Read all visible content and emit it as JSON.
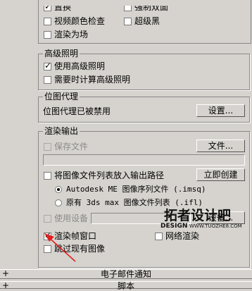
{
  "top": {
    "cut_label_1": "置换",
    "cut_label_2": "强制双面",
    "video_color_check": "视频颜色检查",
    "super_black": "超级黑",
    "render_to_fields": "渲染为场"
  },
  "advanced_lighting": {
    "title": "高级照明",
    "use": "使用高级照明",
    "compute_when_required": "需要时计算高级照明"
  },
  "bitmap_proxies": {
    "title": "位图代理",
    "status": "位图代理已被禁用",
    "settings_button": "设置..."
  },
  "render_output": {
    "title": "渲染输出",
    "save_file": "保存文件",
    "files_button": "文件...",
    "put_image_list": "将图像文件列表放入输出路径",
    "create_now_button": "立即创建",
    "radio_autodesk": "Autodesk ME 图像序列文件 (.imsq)",
    "radio_legacy": "原有 3ds max 图像文件列表 (.ifl)",
    "use_device": "使用设备",
    "devices_button": "设备...",
    "rendered_frame_window": "渲染帧窗口",
    "net_render": "网络渲染",
    "skip_existing": "跳过现有图像"
  },
  "rollouts": {
    "email": "电子邮件通知",
    "scripts": "脚本",
    "plus": "+"
  },
  "watermark": {
    "main": "拓者设计吧",
    "sub": "DESIGN",
    "url": "WWW.TUOZHE8.COM"
  }
}
